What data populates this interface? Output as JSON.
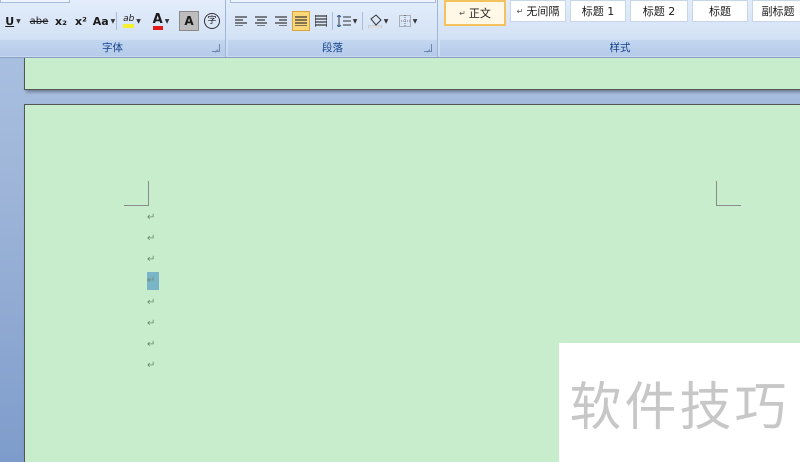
{
  "ribbon": {
    "font_group": {
      "label": "字体",
      "buttons": [
        {
          "name": "underline-button",
          "text": "U"
        },
        {
          "name": "strikethrough-button",
          "text": "abe"
        },
        {
          "name": "subscript-button",
          "text": "x₂"
        },
        {
          "name": "superscript-button",
          "text": "x²"
        },
        {
          "name": "change-case-button",
          "text": "Aa"
        },
        {
          "name": "highlight-button",
          "text": "ab"
        },
        {
          "name": "font-color-button",
          "text": "A"
        },
        {
          "name": "character-shading-button",
          "text": "A"
        },
        {
          "name": "enclose-characters-button",
          "text": "字"
        }
      ]
    },
    "paragraph_group": {
      "label": "段落"
    },
    "styles_group": {
      "label": "样式",
      "styles": [
        {
          "label": "正文",
          "selected": true
        },
        {
          "label": "无间隔",
          "selected": false
        },
        {
          "label": "标题 1",
          "selected": false
        },
        {
          "label": "标题 2",
          "selected": false
        },
        {
          "label": "标题",
          "selected": false
        },
        {
          "label": "副标题",
          "selected": false
        }
      ]
    }
  },
  "document": {
    "paragraph_mark": "↵",
    "paragraph_count": 8,
    "selected_paragraph_index": 3
  },
  "watermark": {
    "text": "软件技巧"
  },
  "colors": {
    "page_background": "#c8edcc",
    "ribbon_background": "#d5e3f6",
    "selection": "#79b5c6",
    "selected_style_border": "#f3c15d"
  }
}
